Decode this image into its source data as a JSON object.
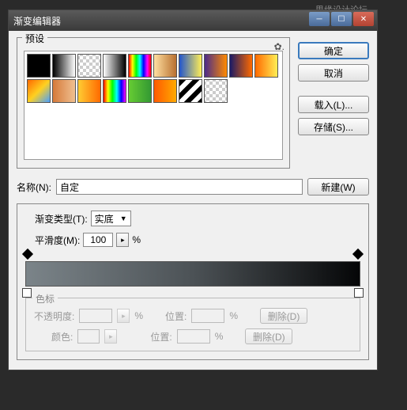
{
  "bg_watermark": "思缘设计论坛",
  "dialog": {
    "title": "渐变编辑器",
    "presets_label": "预设",
    "buttons": {
      "ok": "确定",
      "cancel": "取消",
      "load": "载入(L)...",
      "save": "存储(S)..."
    },
    "name_label": "名称(N):",
    "name_value": "自定",
    "new_btn": "新建(W)",
    "gradient_type_label": "渐变类型(T):",
    "gradient_type_value": "实底",
    "smoothness_label": "平滑度(M):",
    "smoothness_value": "100",
    "percent": "%",
    "stops_label": "色标",
    "opacity_label": "不透明度:",
    "position_label": "位置:",
    "delete_btn": "删除(D)",
    "color_label": "颜色:"
  },
  "swatches": [
    "linear-gradient(90deg,#000,#000)",
    "linear-gradient(90deg,#000,#fff)",
    "repeating-conic-gradient(#ccc 0 25%,#fff 0 50%) 50%/8px 8px",
    "linear-gradient(90deg,#fff,#000)",
    "linear-gradient(90deg,#ff0000,#ffff00,#00ff00,#00ffff,#0000ff,#ff00ff,#ff0000)",
    "linear-gradient(90deg,#ffdfa0,#b87030)",
    "linear-gradient(90deg,#2255cc,#ffee55)",
    "linear-gradient(90deg,#4a2b8a,#ff8a00)",
    "linear-gradient(90deg,#1a1a66,#ff6a00)",
    "linear-gradient(90deg,#ff6a00,#ffee55)",
    "linear-gradient(135deg,#ff6a00,#ffd020,#4aa0ff)",
    "linear-gradient(90deg,#d67a3a,#f0c090)",
    "linear-gradient(90deg,#ffcc33,#ff6a00)",
    "linear-gradient(90deg,#ff0000,#ffff00,#00ff00,#00ffff,#0000ff,#ff00ff)",
    "linear-gradient(90deg,#66cc33,#339933)",
    "linear-gradient(90deg,#ff5a00,#ffaa00)",
    "repeating-linear-gradient(135deg,#000 0 6px,#fff 6px 12px)",
    "repeating-conic-gradient(#ccc 0 25%,#fff 0 50%) 50%/8px 8px"
  ]
}
